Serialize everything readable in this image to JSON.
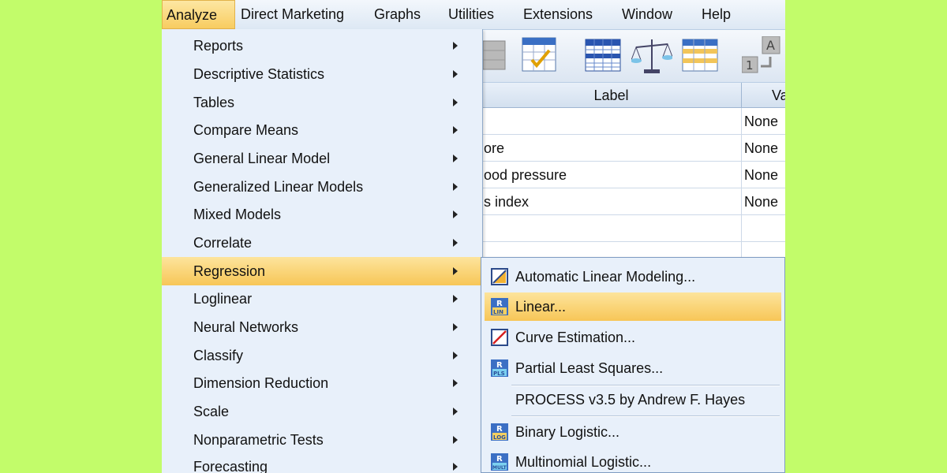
{
  "menubar": {
    "items": [
      {
        "label": "Analyze",
        "active": true
      },
      {
        "label": "Direct Marketing"
      },
      {
        "label": "Graphs"
      },
      {
        "label": "Utilities"
      },
      {
        "label": "Extensions"
      },
      {
        "label": "Window"
      },
      {
        "label": "Help"
      }
    ]
  },
  "toolbar": {
    "icons": [
      "dataset-icon",
      "select-cases-icon",
      "split-file-icon",
      "weight-cases-icon",
      "value-labels-icon",
      "use-variable-sets-icon"
    ]
  },
  "grid": {
    "headers": [
      "Label",
      "Va"
    ],
    "rows": [
      [
        "",
        "None"
      ],
      [
        "ore",
        "None"
      ],
      [
        "ood pressure",
        "None"
      ],
      [
        "s index",
        "None"
      ],
      [
        "",
        ""
      ],
      [
        "",
        ""
      ]
    ]
  },
  "analyze_menu": {
    "items": [
      {
        "label": "Reports"
      },
      {
        "label": "Descriptive Statistics"
      },
      {
        "label": "Tables"
      },
      {
        "label": "Compare Means"
      },
      {
        "label": "General Linear Model"
      },
      {
        "label": "Generalized Linear Models"
      },
      {
        "label": "Mixed Models"
      },
      {
        "label": "Correlate"
      },
      {
        "label": "Regression",
        "highlighted": true
      },
      {
        "label": "Loglinear"
      },
      {
        "label": "Neural Networks"
      },
      {
        "label": "Classify"
      },
      {
        "label": "Dimension Reduction"
      },
      {
        "label": "Scale"
      },
      {
        "label": "Nonparametric Tests"
      },
      {
        "label": "Forecasting"
      }
    ]
  },
  "regression_menu": {
    "items": [
      {
        "label": "Automatic Linear Modeling...",
        "icon": "automatic-linear-modeling-icon"
      },
      {
        "label": "Linear...",
        "icon": "linear-regression-icon",
        "highlighted": true
      },
      {
        "label": "Curve Estimation...",
        "icon": "curve-estimation-icon"
      },
      {
        "label": "Partial Least Squares...",
        "icon": "partial-least-squares-icon"
      },
      {
        "label": "PROCESS v3.5 by Andrew F. Hayes",
        "icon": ""
      },
      {
        "label": "Binary Logistic...",
        "icon": "binary-logistic-icon"
      },
      {
        "label": "Multinomial Logistic...",
        "icon": "multinomial-logistic-icon"
      }
    ]
  },
  "colors": {
    "background": "#c2fc6a",
    "menu": "#e8f0fa",
    "highlight": "#f7c657"
  }
}
